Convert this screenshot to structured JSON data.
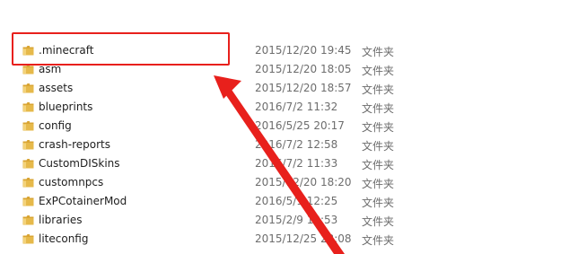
{
  "file_list": {
    "rows": [
      {
        "name": ".minecraft",
        "date": "2015/12/20 19:45",
        "type": "文件夹",
        "icon": "folder-icon"
      },
      {
        "name": "asm",
        "date": "2015/12/20 18:05",
        "type": "文件夹",
        "icon": "folder-icon"
      },
      {
        "name": "assets",
        "date": "2015/12/20 18:57",
        "type": "文件夹",
        "icon": "folder-icon"
      },
      {
        "name": "blueprints",
        "date": "2016/7/2 11:32",
        "type": "文件夹",
        "icon": "folder-icon"
      },
      {
        "name": "config",
        "date": "2016/5/25 20:17",
        "type": "文件夹",
        "icon": "folder-icon"
      },
      {
        "name": "crash-reports",
        "date": "2016/7/2 12:58",
        "type": "文件夹",
        "icon": "folder-icon"
      },
      {
        "name": "CustomDISkins",
        "date": "2016/7/2 11:33",
        "type": "文件夹",
        "icon": "folder-icon"
      },
      {
        "name": "customnpcs",
        "date": "2015/12/20 18:20",
        "type": "文件夹",
        "icon": "folder-icon"
      },
      {
        "name": "ExPCotainerMod",
        "date": "2016/5/1 12:25",
        "type": "文件夹",
        "icon": "folder-icon"
      },
      {
        "name": "libraries",
        "date": "2015/2/9 19:53",
        "type": "文件夹",
        "icon": "folder-icon"
      },
      {
        "name": "liteconfig",
        "date": "2015/12/25 23:08",
        "type": "文件夹",
        "icon": "folder-icon"
      }
    ]
  },
  "annotation": {
    "highlighted_item": ".minecraft",
    "highlight_color": "#e8201c",
    "arrow_color": "#e8201c"
  },
  "colors": {
    "folder_body": "#e6b94a",
    "folder_tab": "#d9a534",
    "date_text": "#6d6d6d",
    "name_text": "#1e1e1e"
  }
}
